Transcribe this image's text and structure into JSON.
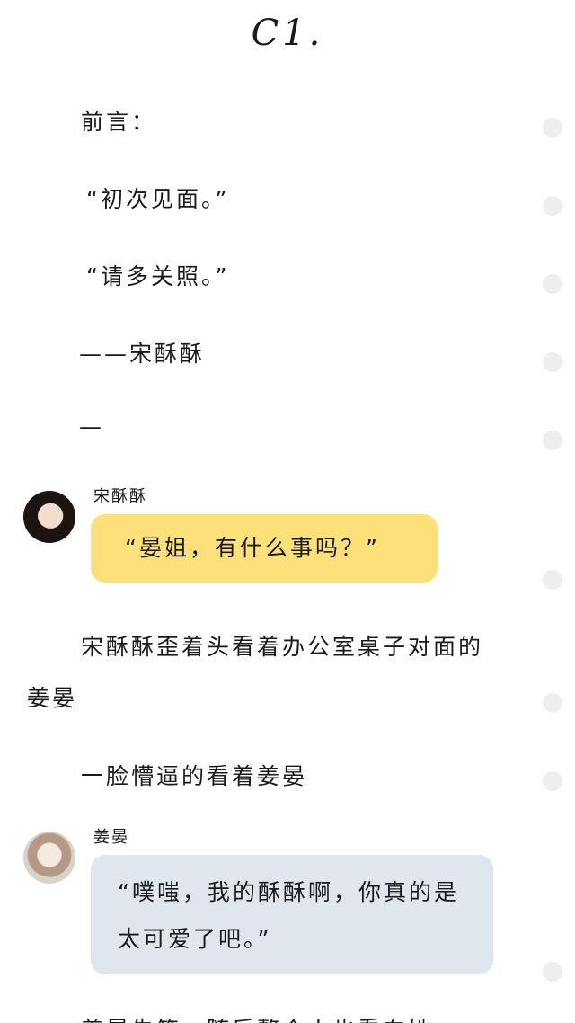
{
  "title": "C1.",
  "paragraphs": {
    "foreword": "前言：",
    "quote1": "“初次见面。”",
    "quote2": "“请多关照。”",
    "signature": "——宋酥酥",
    "dash": "—",
    "narration1_line1": "宋酥酥歪着头看着办公室桌子对面的",
    "narration1_line2": "姜晏",
    "narration2": "一脸懵逼的看着姜晏",
    "narration3_partial": "姜晏失笑，随后整个人也看向她"
  },
  "messages": [
    {
      "speaker": "宋酥酥",
      "text": "“晏姐，有什么事吗？”",
      "bubble_color": "#fde07a"
    },
    {
      "speaker": "姜晏",
      "text": "“噗嗤，我的酥酥啊，你真的是太可爱了吧。”",
      "bubble_color": "#dfe6ee"
    }
  ],
  "colors": {
    "background": "#ffffff",
    "side_dot": "#eeeeee",
    "text": "#1a1a1a"
  }
}
